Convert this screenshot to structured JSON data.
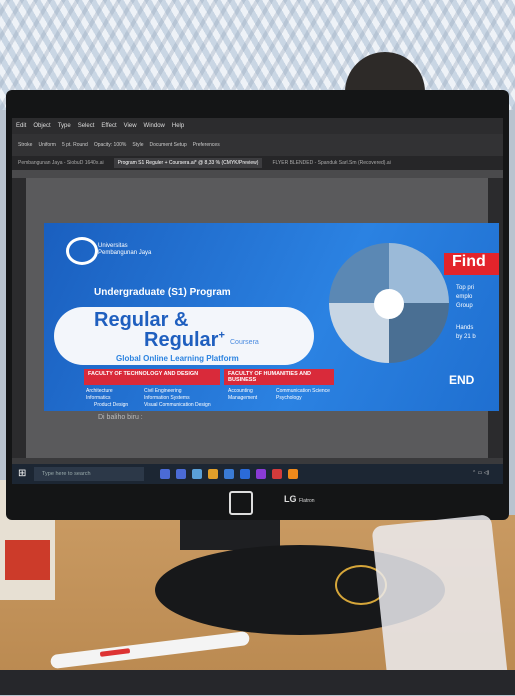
{
  "app": {
    "menu": [
      "Edit",
      "Object",
      "Type",
      "Select",
      "Effect",
      "View",
      "Window",
      "Help"
    ],
    "toolbar": [
      "Stroke",
      "Uniform",
      "5 pt. Round",
      "Opacity: 100%",
      "Style",
      "Document Setup",
      "Preferences"
    ],
    "tabs": [
      "Pembangunan Jaya - SiobuD 1640x.ai",
      "Program S1 Reguler + Coursera.ai* @ 8,33 % (CMYK/Preview)",
      "FLYER BLENDED - Spanduk Sarl.Sm (Recovered).ai"
    ],
    "active_tab_index": 1
  },
  "design": {
    "university": "Universitas Pembangunan Jaya",
    "program": "Undergraduate (S1) Program",
    "regular1": "Regular &",
    "regular2": "Regular",
    "plus": "+",
    "coursera": "Coursera",
    "global": "Global Online Learning Platform",
    "faculty1": "FACULTY OF TECHNOLOGY AND DESIGN",
    "faculty2": "FACULTY OF HUMANITIES AND BUSINESS",
    "fac1_programs": [
      "Architecture",
      "Informatics",
      "Product Design",
      "Civil Engineering",
      "Information Systems",
      "Visual Communication Design"
    ],
    "fac2_programs": [
      "Accounting",
      "Management",
      "Communication Science",
      "Psychology"
    ],
    "find": "Find",
    "right_lines": [
      "Top pri",
      "emplo",
      "Group",
      "Hands",
      "by 21 b"
    ],
    "end": "END"
  },
  "caption": "Di baliho biru :",
  "taskbar": {
    "search_placeholder": "Type here to search",
    "app_icons": [
      "#4b6bd6",
      "#4b6bd6",
      "#5aa0d8",
      "#e2a02a",
      "#3a7bd5",
      "#2b6bd8",
      "#8a3bd6",
      "#d33b3b",
      "#f08a1b"
    ]
  },
  "monitor": {
    "brand": "LG",
    "model": "Flatron"
  }
}
